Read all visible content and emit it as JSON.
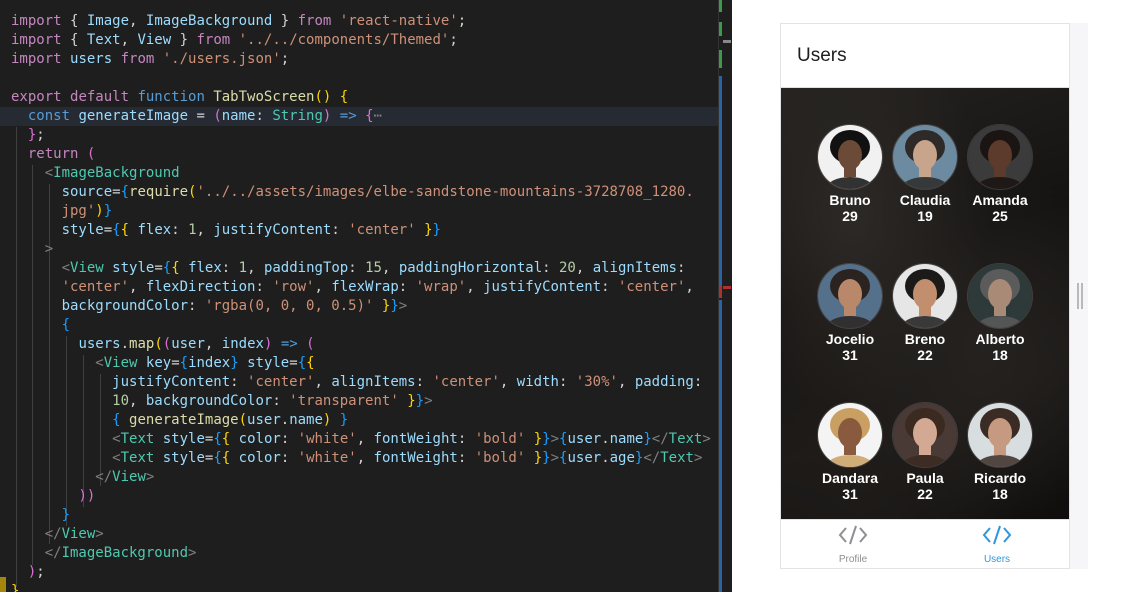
{
  "editor": {
    "lines": [
      [
        [
          "k",
          "import "
        ],
        [
          "p",
          "{ "
        ],
        [
          "v",
          "Image"
        ],
        [
          "p",
          ", "
        ],
        [
          "v",
          "ImageBackground"
        ],
        [
          "p",
          " } "
        ],
        [
          "k",
          "from "
        ],
        [
          "s",
          "'react-native'"
        ],
        [
          "p",
          ";"
        ]
      ],
      [
        [
          "k",
          "import "
        ],
        [
          "p",
          "{ "
        ],
        [
          "v",
          "Text"
        ],
        [
          "p",
          ", "
        ],
        [
          "v",
          "View"
        ],
        [
          "p",
          " } "
        ],
        [
          "k",
          "from "
        ],
        [
          "s",
          "'../../components/Themed'"
        ],
        [
          "p",
          ";"
        ]
      ],
      [
        [
          "k",
          "import "
        ],
        [
          "v",
          "users "
        ],
        [
          "k",
          "from "
        ],
        [
          "s",
          "'./users.json'"
        ],
        [
          "p",
          ";"
        ]
      ],
      [],
      [
        [
          "k",
          "export "
        ],
        [
          "k",
          "default "
        ],
        [
          "kw",
          "function "
        ],
        [
          "fn",
          "TabTwoScreen"
        ],
        [
          "br",
          "()"
        ],
        [
          "p",
          " "
        ],
        [
          "br",
          "{"
        ]
      ],
      [
        [
          "p",
          "  "
        ],
        [
          "kw",
          "const "
        ],
        [
          "v",
          "generateImage"
        ],
        [
          "p",
          " = "
        ],
        [
          "br2",
          "("
        ],
        [
          "v",
          "name"
        ],
        [
          "p",
          ": "
        ],
        [
          "t",
          "String"
        ],
        [
          "br2",
          ")"
        ],
        [
          "p",
          " "
        ],
        [
          "kw",
          "=>"
        ],
        [
          "p",
          " "
        ],
        [
          "br2",
          "{"
        ],
        [
          "tg",
          "⋯"
        ]
      ],
      [
        [
          "p",
          "  "
        ],
        [
          "br2",
          "}"
        ],
        [
          "p",
          ";"
        ]
      ],
      [
        [
          "p",
          "  "
        ],
        [
          "k",
          "return "
        ],
        [
          "br2",
          "("
        ]
      ],
      [
        [
          "p",
          "    "
        ],
        [
          "tg",
          "<"
        ],
        [
          "t",
          "ImageBackground"
        ]
      ],
      [
        [
          "p",
          "      "
        ],
        [
          "v",
          "source"
        ],
        [
          "p",
          "="
        ],
        [
          "br3",
          "{"
        ],
        [
          "fn",
          "require"
        ],
        [
          "br",
          "("
        ],
        [
          "s",
          "'../../assets/images/elbe-sandstone-mountains-3728708_1280."
        ]
      ],
      [
        [
          "s",
          "      jpg'"
        ],
        [
          "br",
          ")"
        ],
        [
          "br3",
          "}"
        ]
      ],
      [
        [
          "p",
          "      "
        ],
        [
          "v",
          "style"
        ],
        [
          "p",
          "="
        ],
        [
          "br3",
          "{"
        ],
        [
          "br",
          "{"
        ],
        [
          "p",
          " "
        ],
        [
          "v",
          "flex"
        ],
        [
          "p",
          ": "
        ],
        [
          "n",
          "1"
        ],
        [
          "p",
          ", "
        ],
        [
          "v",
          "justifyContent"
        ],
        [
          "p",
          ": "
        ],
        [
          "s",
          "'center'"
        ],
        [
          "p",
          " "
        ],
        [
          "br",
          "}"
        ],
        [
          "br3",
          "}"
        ]
      ],
      [
        [
          "p",
          "    "
        ],
        [
          "tg",
          ">"
        ]
      ],
      [
        [
          "p",
          "      "
        ],
        [
          "tg",
          "<"
        ],
        [
          "t",
          "View "
        ],
        [
          "v",
          "style"
        ],
        [
          "p",
          "="
        ],
        [
          "br3",
          "{"
        ],
        [
          "br",
          "{"
        ],
        [
          "p",
          " "
        ],
        [
          "v",
          "flex"
        ],
        [
          "p",
          ": "
        ],
        [
          "n",
          "1"
        ],
        [
          "p",
          ", "
        ],
        [
          "v",
          "paddingTop"
        ],
        [
          "p",
          ": "
        ],
        [
          "n",
          "15"
        ],
        [
          "p",
          ", "
        ],
        [
          "v",
          "paddingHorizontal"
        ],
        [
          "p",
          ": "
        ],
        [
          "n",
          "20"
        ],
        [
          "p",
          ", "
        ],
        [
          "v",
          "alignItems"
        ],
        [
          "p",
          ":"
        ]
      ],
      [
        [
          "s",
          "      'center'"
        ],
        [
          "p",
          ", "
        ],
        [
          "v",
          "flexDirection"
        ],
        [
          "p",
          ": "
        ],
        [
          "s",
          "'row'"
        ],
        [
          "p",
          ", "
        ],
        [
          "v",
          "flexWrap"
        ],
        [
          "p",
          ": "
        ],
        [
          "s",
          "'wrap'"
        ],
        [
          "p",
          ", "
        ],
        [
          "v",
          "justifyContent"
        ],
        [
          "p",
          ": "
        ],
        [
          "s",
          "'center'"
        ],
        [
          "p",
          ","
        ]
      ],
      [
        [
          "p",
          "      "
        ],
        [
          "v",
          "backgroundColor"
        ],
        [
          "p",
          ": "
        ],
        [
          "s",
          "'rgba(0, 0, 0, 0.5)'"
        ],
        [
          "p",
          " "
        ],
        [
          "br",
          "}"
        ],
        [
          "br3",
          "}"
        ],
        [
          "tg",
          ">"
        ]
      ],
      [
        [
          "p",
          "      "
        ],
        [
          "br3",
          "{"
        ]
      ],
      [
        [
          "p",
          "        "
        ],
        [
          "v",
          "users"
        ],
        [
          "p",
          "."
        ],
        [
          "fn",
          "map"
        ],
        [
          "br",
          "("
        ],
        [
          "br2",
          "("
        ],
        [
          "v",
          "user"
        ],
        [
          "p",
          ", "
        ],
        [
          "v",
          "index"
        ],
        [
          "br2",
          ")"
        ],
        [
          "p",
          " "
        ],
        [
          "kw",
          "=>"
        ],
        [
          "p",
          " "
        ],
        [
          "br2",
          "("
        ]
      ],
      [
        [
          "p",
          "          "
        ],
        [
          "tg",
          "<"
        ],
        [
          "t",
          "View "
        ],
        [
          "v",
          "key"
        ],
        [
          "p",
          "="
        ],
        [
          "br3",
          "{"
        ],
        [
          "v",
          "index"
        ],
        [
          "br3",
          "}"
        ],
        [
          "p",
          " "
        ],
        [
          "v",
          "style"
        ],
        [
          "p",
          "="
        ],
        [
          "br3",
          "{"
        ],
        [
          "br",
          "{"
        ]
      ],
      [
        [
          "p",
          "            "
        ],
        [
          "v",
          "justifyContent"
        ],
        [
          "p",
          ": "
        ],
        [
          "s",
          "'center'"
        ],
        [
          "p",
          ", "
        ],
        [
          "v",
          "alignItems"
        ],
        [
          "p",
          ": "
        ],
        [
          "s",
          "'center'"
        ],
        [
          "p",
          ", "
        ],
        [
          "v",
          "width"
        ],
        [
          "p",
          ": "
        ],
        [
          "s",
          "'30%'"
        ],
        [
          "p",
          ", "
        ],
        [
          "v",
          "padding"
        ],
        [
          "p",
          ":"
        ]
      ],
      [
        [
          "n",
          "            10"
        ],
        [
          "p",
          ", "
        ],
        [
          "v",
          "backgroundColor"
        ],
        [
          "p",
          ": "
        ],
        [
          "s",
          "'transparent'"
        ],
        [
          "p",
          " "
        ],
        [
          "br",
          "}"
        ],
        [
          "br3",
          "}"
        ],
        [
          "tg",
          ">"
        ]
      ],
      [
        [
          "p",
          "            "
        ],
        [
          "br3",
          "{"
        ],
        [
          "p",
          " "
        ],
        [
          "fn",
          "generateImage"
        ],
        [
          "br",
          "("
        ],
        [
          "v",
          "user"
        ],
        [
          "p",
          "."
        ],
        [
          "v",
          "name"
        ],
        [
          "br",
          ")"
        ],
        [
          "p",
          " "
        ],
        [
          "br3",
          "}"
        ]
      ],
      [
        [
          "p",
          "            "
        ],
        [
          "tg",
          "<"
        ],
        [
          "t",
          "Text "
        ],
        [
          "v",
          "style"
        ],
        [
          "p",
          "="
        ],
        [
          "br3",
          "{"
        ],
        [
          "br",
          "{"
        ],
        [
          "p",
          " "
        ],
        [
          "v",
          "color"
        ],
        [
          "p",
          ": "
        ],
        [
          "s",
          "'white'"
        ],
        [
          "p",
          ", "
        ],
        [
          "v",
          "fontWeight"
        ],
        [
          "p",
          ": "
        ],
        [
          "s",
          "'bold'"
        ],
        [
          "p",
          " "
        ],
        [
          "br",
          "}"
        ],
        [
          "br3",
          "}"
        ],
        [
          "tg",
          ">"
        ],
        [
          "br3",
          "{"
        ],
        [
          "v",
          "user"
        ],
        [
          "p",
          "."
        ],
        [
          "v",
          "name"
        ],
        [
          "br3",
          "}"
        ],
        [
          "tg",
          "</"
        ],
        [
          "t",
          "Text"
        ],
        [
          "tg",
          ">"
        ]
      ],
      [
        [
          "p",
          "            "
        ],
        [
          "tg",
          "<"
        ],
        [
          "t",
          "Text "
        ],
        [
          "v",
          "style"
        ],
        [
          "p",
          "="
        ],
        [
          "br3",
          "{"
        ],
        [
          "br",
          "{"
        ],
        [
          "p",
          " "
        ],
        [
          "v",
          "color"
        ],
        [
          "p",
          ": "
        ],
        [
          "s",
          "'white'"
        ],
        [
          "p",
          ", "
        ],
        [
          "v",
          "fontWeight"
        ],
        [
          "p",
          ": "
        ],
        [
          "s",
          "'bold'"
        ],
        [
          "p",
          " "
        ],
        [
          "br",
          "}"
        ],
        [
          "br3",
          "}"
        ],
        [
          "tg",
          ">"
        ],
        [
          "br3",
          "{"
        ],
        [
          "v",
          "user"
        ],
        [
          "p",
          "."
        ],
        [
          "v",
          "age"
        ],
        [
          "br3",
          "}"
        ],
        [
          "tg",
          "</"
        ],
        [
          "t",
          "Text"
        ],
        [
          "tg",
          ">"
        ]
      ],
      [
        [
          "p",
          "          "
        ],
        [
          "tg",
          "</"
        ],
        [
          "t",
          "View"
        ],
        [
          "tg",
          ">"
        ]
      ],
      [
        [
          "p",
          "        "
        ],
        [
          "br2",
          "))"
        ]
      ],
      [
        [
          "p",
          "      "
        ],
        [
          "br3",
          "}"
        ]
      ],
      [
        [
          "p",
          "    "
        ],
        [
          "tg",
          "</"
        ],
        [
          "t",
          "View"
        ],
        [
          "tg",
          ">"
        ]
      ],
      [
        [
          "p",
          "    "
        ],
        [
          "tg",
          "</"
        ],
        [
          "t",
          "ImageBackground"
        ],
        [
          "tg",
          ">"
        ]
      ],
      [
        [
          "p",
          "  "
        ],
        [
          "br2",
          ")"
        ],
        [
          "p",
          ";"
        ]
      ],
      [
        [
          "br",
          "}"
        ]
      ]
    ],
    "highlighted_line": 5
  },
  "phone": {
    "header_title": "Users",
    "users": [
      {
        "name": "Bruno",
        "age": "29",
        "skin": "#6b4a38",
        "hair": "#111111",
        "bg": "#f1f1f1"
      },
      {
        "name": "Claudia",
        "age": "19",
        "skin": "#c8a48c",
        "hair": "#2d2a28",
        "bg": "#6c8aa0"
      },
      {
        "name": "Amanda",
        "age": "25",
        "skin": "#5d3b2c",
        "hair": "#1a1412",
        "bg": "#3b3b3b"
      },
      {
        "name": "Jocelio",
        "age": "31",
        "skin": "#b9876a",
        "hair": "#2b2320",
        "bg": "#55708a"
      },
      {
        "name": "Breno",
        "age": "22",
        "skin": "#c28f6e",
        "hair": "#1c1a18",
        "bg": "#e6e6e6"
      },
      {
        "name": "Alberto",
        "age": "18",
        "skin": "#a88a76",
        "hair": "#5b5b5b",
        "bg": "#2e3a3a"
      },
      {
        "name": "Dandara",
        "age": "31",
        "skin": "#8a5a3e",
        "hair": "#c9a062",
        "bg": "#f4f4f4"
      },
      {
        "name": "Paula",
        "age": "22",
        "skin": "#d3a994",
        "hair": "#3a2a20",
        "bg": "#4a3a36"
      },
      {
        "name": "Ricardo",
        "age": "18",
        "skin": "#c59a80",
        "hair": "#3a2c24",
        "bg": "#d8dde0"
      }
    ],
    "tabs": [
      {
        "label": "Profile",
        "icon": "code-icon",
        "active": false,
        "color": "#8e8e93"
      },
      {
        "label": "Users",
        "icon": "code-icon",
        "active": true,
        "color": "#2f95dc"
      }
    ]
  }
}
